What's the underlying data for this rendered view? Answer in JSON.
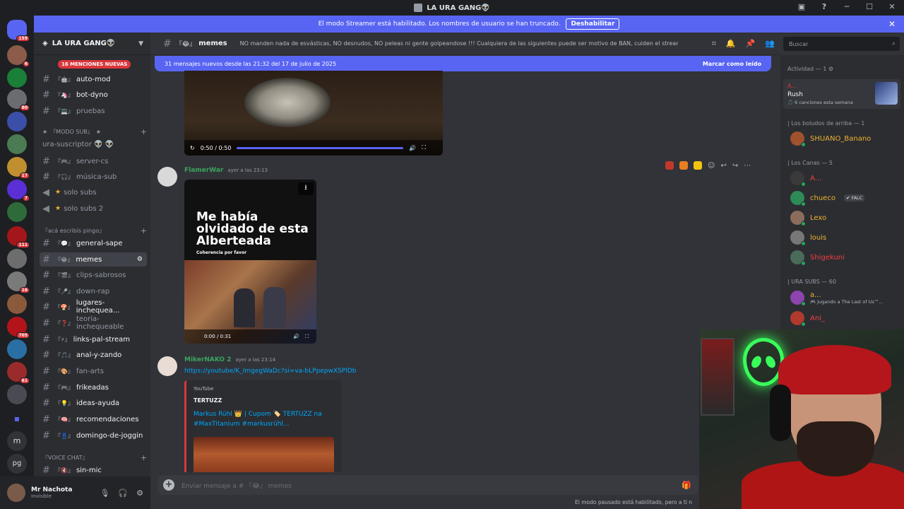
{
  "window": {
    "title": "LA URA GANG👽"
  },
  "banner": {
    "text": "El modo Streamer está habilitado. Los nombres de usuario se han truncado.",
    "button": "Deshabilitar"
  },
  "guilds": {
    "badges": [
      "159",
      "6",
      "80",
      "17",
      "7",
      "111",
      "16",
      "705",
      "61"
    ],
    "letters": [
      "m",
      "pg"
    ]
  },
  "server": {
    "name": "LA URA GANG👽",
    "mentions_pill": "16 MENCIONES NUEVAS",
    "channels": [
      {
        "name": "auto-mod",
        "emoji": "『🤖』"
      },
      {
        "name": "bot-dyno",
        "emoji": "『🦄』"
      },
      {
        "name": "pruebas",
        "emoji": "『💻』"
      }
    ],
    "cat_sub": "『MODO SUB』",
    "sub_channels": [
      {
        "name": "ura-suscriptor 👽 👽"
      },
      {
        "name": "server-cs",
        "emoji": "『🎮』"
      },
      {
        "name": "música-sub",
        "emoji": "『🎧』"
      },
      {
        "name": "solo subs"
      },
      {
        "name": "solo subs 2"
      }
    ],
    "cat_acá": "『acá escribís pingo』",
    "chat_channels": [
      {
        "name": "general-sape",
        "emoji": "『💬』"
      },
      {
        "name": "memes",
        "emoji": "『😂』"
      },
      {
        "name": "clips-sabrosos",
        "emoji": "『🎬』"
      },
      {
        "name": "down-rap",
        "emoji": "『🎤』"
      },
      {
        "name": "lugares-inchequea...",
        "emoji": "『🍄』"
      },
      {
        "name": "teoria-inchequeable",
        "emoji": "『❓』"
      },
      {
        "name": "links-pal-stream",
        "emoji": "『⚡』"
      },
      {
        "name": "anal-y-zando",
        "emoji": "『🎵』"
      },
      {
        "name": "fan-arts",
        "emoji": "『🎨』"
      },
      {
        "name": "frikeadas",
        "emoji": "『🎮』"
      },
      {
        "name": "ideas-ayuda",
        "emoji": "『💡』"
      },
      {
        "name": "recomendaciones",
        "emoji": "『🧠』"
      },
      {
        "name": "domingo-de-joggin",
        "emoji": "『👖』"
      }
    ],
    "cat_voice": "『VOICE CHAT』",
    "voice_channels": [
      {
        "name": "sin-mic",
        "emoji": "『🔇』"
      }
    ]
  },
  "user": {
    "name": "Mr Nachota",
    "status": "Invisible"
  },
  "chat": {
    "channel_name": "memes",
    "channel_emoji": "『😂』",
    "topic": "NO manden nada de esvásticas, NO desnudos, NO peleas ni gente golpeandose !!! Cualquiera de las siguientes puede ser motivo de BAN, cuiden el stream!",
    "search_placeholder": "Buscar",
    "new_messages": "31 mensajes nuevos desde las 21:32 del 17 de julio de 2025",
    "mark_read": "Marcar como leído",
    "video1_time": "0:50 / 0:50",
    "msg1": {
      "author": "FlamerWar",
      "time": "ayer a las 23:13",
      "video_title": "Me había olvidado de esta Alberteada",
      "video_sub": "Coherencia por favor",
      "video_time": "0:00 / 0:31"
    },
    "msg2": {
      "author": "MikerNAKO 2",
      "time": "ayer a las 23:14",
      "link": "https://youtube/K_ImgegWaDc?si=va-bLPpepwXSPIDb",
      "embed_provider": "YouTube",
      "embed_author": "TERTUZZ",
      "embed_title": "Markus Rühl 👑 | Cupom 🏷️ TERTUZZ na #MaxTitanium #markusrühl..."
    },
    "composer_placeholder": "Enviar mensaje a # 『😂』 memes",
    "paused_notice": "El modo pausado está habilitado, pero a ti n"
  },
  "members": {
    "activity_title": "Actividad — 1",
    "activity": {
      "name": "A...",
      "title": "Rush",
      "sub": "🎵 6 canciones esta semana"
    },
    "groups": [
      {
        "title": "| Los boludos de arriba — 1",
        "items": [
          {
            "name": "SHUANO_Banano",
            "color": "#f0b232"
          }
        ]
      },
      {
        "title": "| Los Canas — 5",
        "items": [
          {
            "name": "A...",
            "color": "#f23f43"
          },
          {
            "name": "chueco",
            "color": "#f0b232",
            "tag": "✔ FALC"
          },
          {
            "name": "Lexo",
            "color": "#f0b232"
          },
          {
            "name": "louis",
            "color": "#f0b232"
          },
          {
            "name": "Shigekuni",
            "color": "#f23f43"
          }
        ]
      },
      {
        "title": "| URA SUBS — 60",
        "items": [
          {
            "name": "a...",
            "color": "#f0b232",
            "sub": "🎮 Jugando a The Last of Us™..."
          },
          {
            "name": "Ani_",
            "color": "#f23f43"
          }
        ]
      }
    ]
  },
  "colors": {
    "accent": "#5865f2",
    "online": "#23a559",
    "danger": "#da373c"
  }
}
